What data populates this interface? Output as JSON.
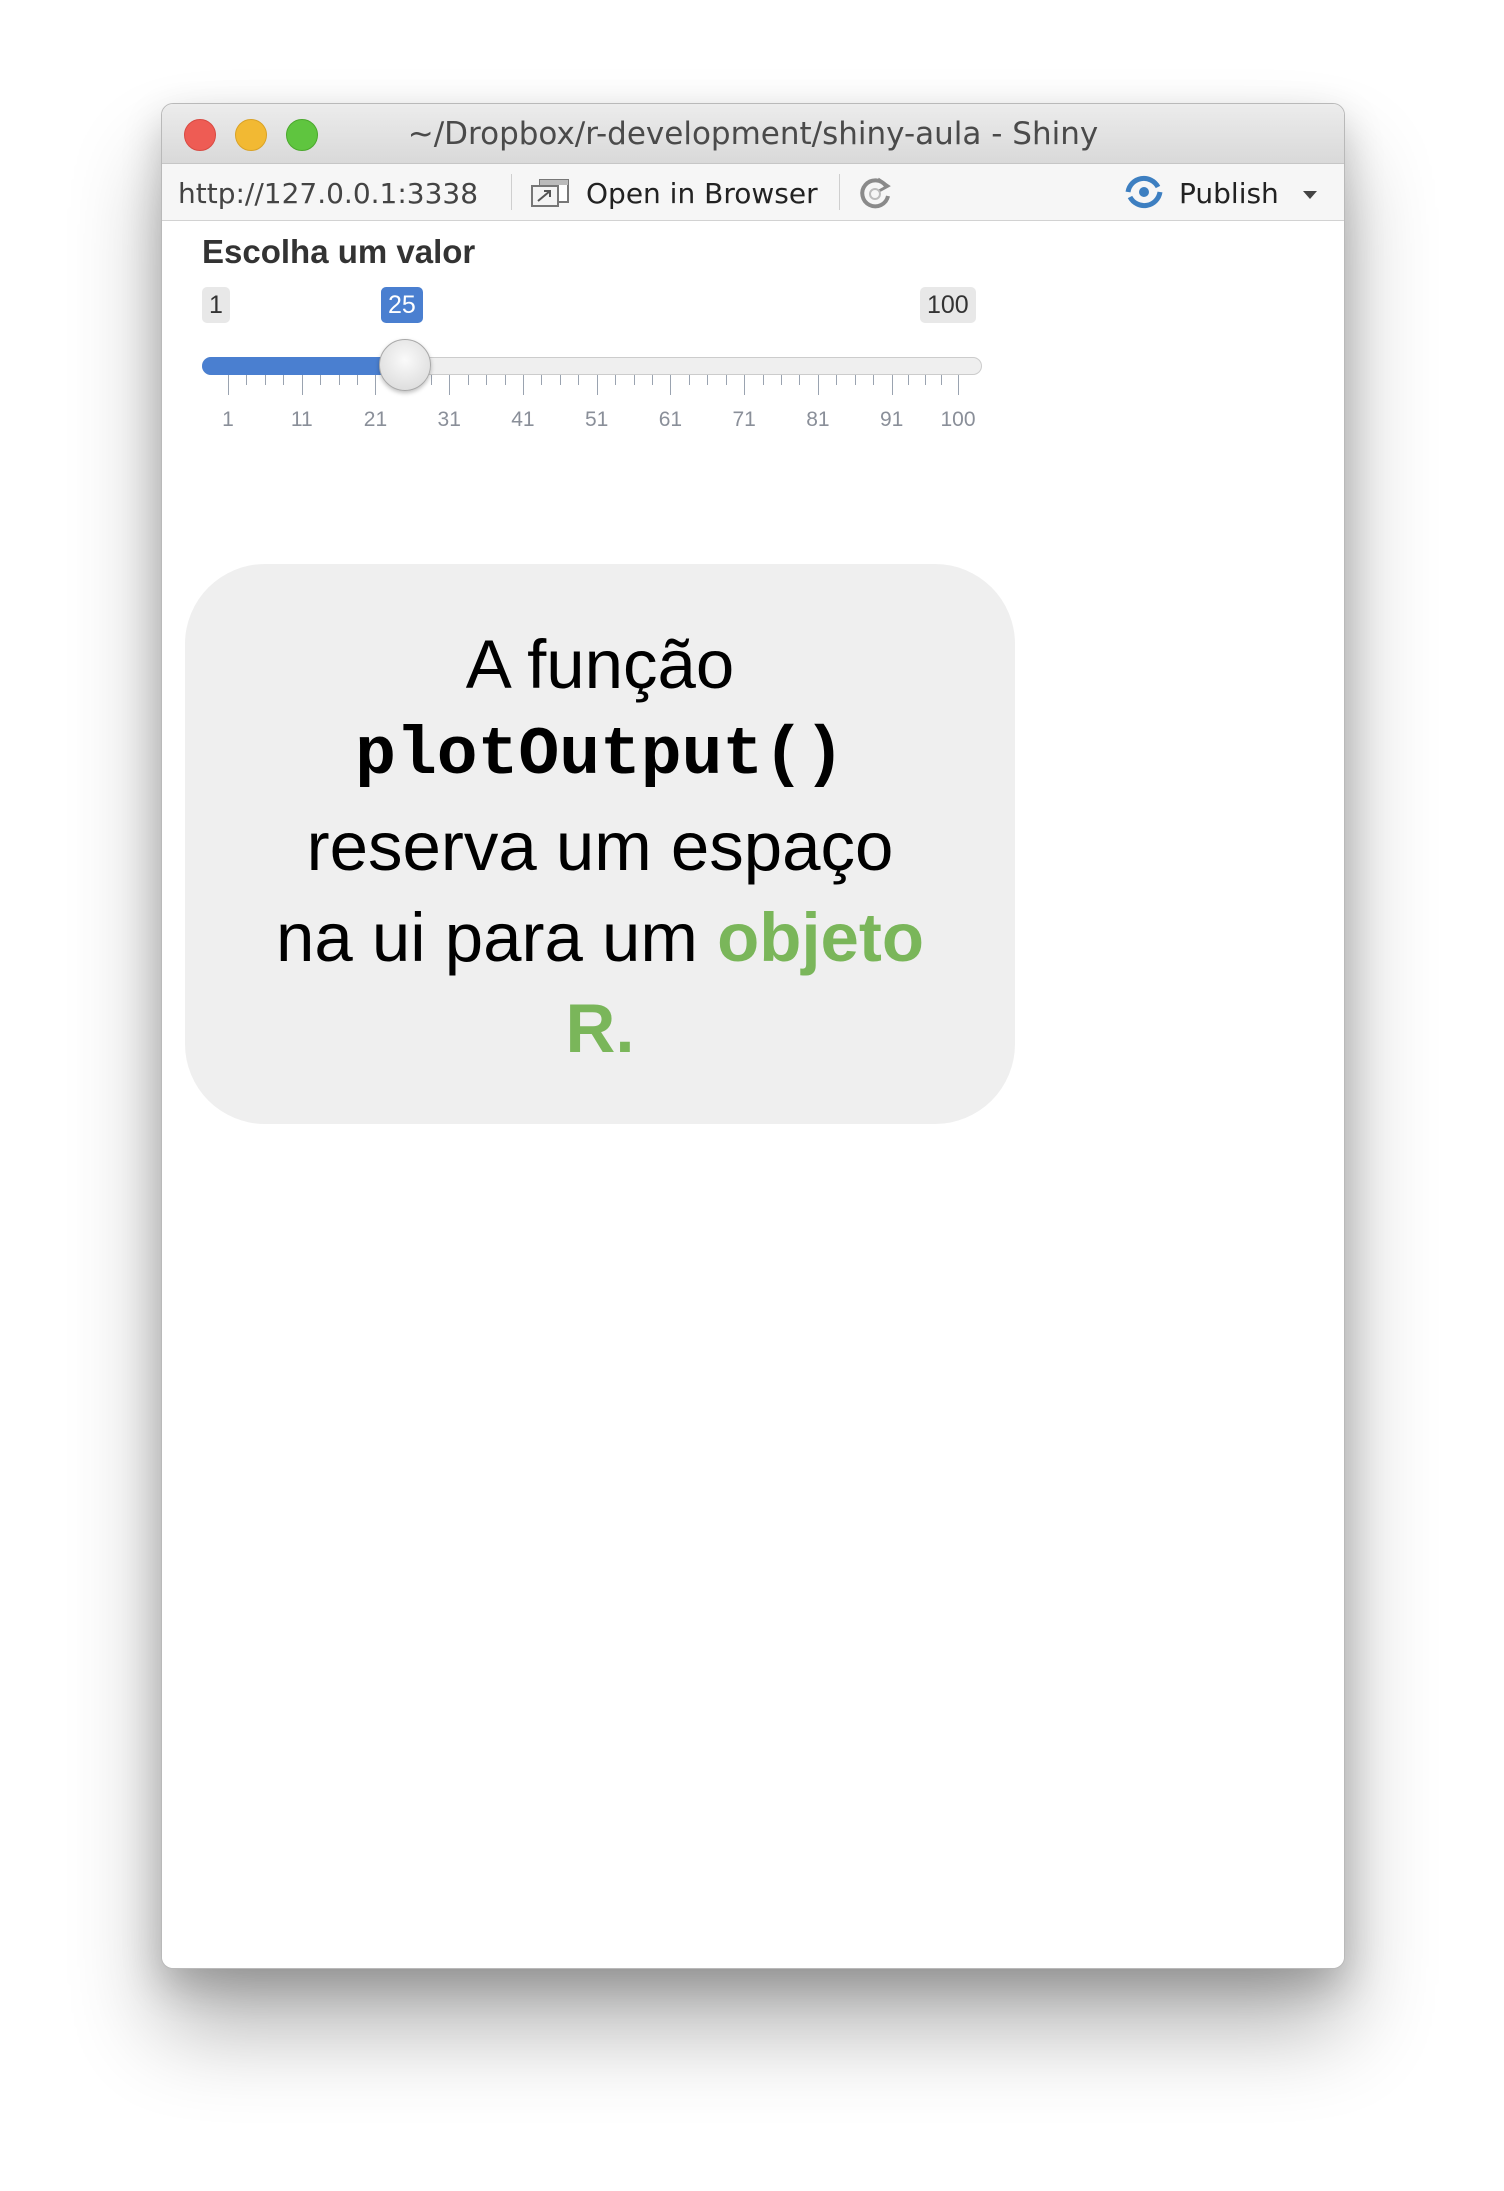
{
  "window": {
    "title": "~/Dropbox/r-development/shiny-aula - Shiny"
  },
  "toolbar": {
    "url": "http://127.0.0.1:3338",
    "open_browser_label": "Open in Browser",
    "publish_label": "Publish"
  },
  "slider": {
    "label": "Escolha um valor",
    "min": 1,
    "max": 100,
    "value": 25,
    "min_label": "1",
    "max_label": "100",
    "value_label": "25",
    "tick_labels": [
      "1",
      "11",
      "21",
      "31",
      "41",
      "51",
      "61",
      "71",
      "81",
      "91",
      "100"
    ],
    "accent_color": "#4a7fd0"
  },
  "callout": {
    "line1": "A função",
    "code": "plotOutput()",
    "line3": "reserva um espaço",
    "line4": "na ui para um",
    "highlight_part1": "objeto",
    "highlight_part2": "R.",
    "highlight_color": "#7ab65a"
  }
}
